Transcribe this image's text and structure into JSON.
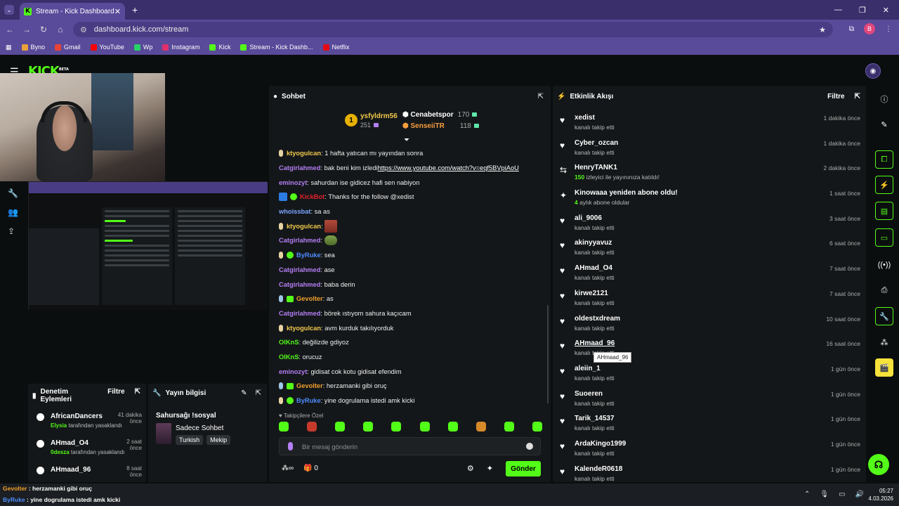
{
  "browser": {
    "tab_title": "Stream - Kick Dashboard",
    "url": "dashboard.kick.com/stream",
    "profile_initial": "B",
    "bookmarks": [
      {
        "label": "Byno",
        "color": "#e9a23b"
      },
      {
        "label": "Gmail",
        "color": "#ea4335"
      },
      {
        "label": "YouTube",
        "color": "#ff0000"
      },
      {
        "label": "Wp",
        "color": "#25d366"
      },
      {
        "label": "Instagram",
        "color": "#e1306c"
      },
      {
        "label": "Kick",
        "color": "#53fc18"
      },
      {
        "label": "Stream - Kick Dashb...",
        "color": "#53fc18"
      },
      {
        "label": "Netflix",
        "color": "#e50914"
      }
    ]
  },
  "kick": {
    "logo": "KICK",
    "logo_sup": "BETA"
  },
  "chat": {
    "title": "Sohbet",
    "leaderboard": {
      "rank": "1",
      "top_user": "ysfyldrm56",
      "top_count": "251",
      "second_user": "Cenabetspor",
      "second_count": "170",
      "third_user": "SenseiiTR",
      "third_count": "118"
    },
    "messages": [
      {
        "badges": "sub",
        "user": "ktyogulcan",
        "color": "#f2c94c",
        "text": "1 hafta yatıcan mı yayından sonra"
      },
      {
        "badges": "",
        "user": "Catgirlahmed",
        "color": "#b47ff5",
        "text": "bak beni kim izledi ",
        "link": "https://www.youtube.com/watch?v=eqf5BVpiAoU"
      },
      {
        "badges": "",
        "user": "eminozyt",
        "color": "#b47ff5",
        "text": "sahurdan ise gidicez hafi sen nabiyon"
      },
      {
        "badges": "bot",
        "user": "KickBot",
        "color": "#e0202a",
        "text": "Thanks for the follow @xedist"
      },
      {
        "badges": "",
        "user": "whoissbat",
        "color": "#7aa6ff",
        "text": "sa as"
      },
      {
        "badges": "sub",
        "user": "ktyogulcan",
        "color": "#f2c94c",
        "text": "",
        "emote": "red"
      },
      {
        "badges": "",
        "user": "Catgirlahmed",
        "color": "#b47ff5",
        "text": "",
        "emote": "frog"
      },
      {
        "badges": "subv",
        "user": "ByRuke",
        "color": "#4e8cff",
        "text": "sea"
      },
      {
        "badges": "",
        "user": "Catgirlahmed",
        "color": "#b47ff5",
        "text": "ase"
      },
      {
        "badges": "",
        "user": "Catgirlahmed",
        "color": "#b47ff5",
        "text": "baba derin"
      },
      {
        "badges": "blueg",
        "user": "Gevolter",
        "color": "#f0a02a",
        "text": "as"
      },
      {
        "badges": "",
        "user": "Catgirlahmed",
        "color": "#b47ff5",
        "text": "börek ıstıyom sahura kaçıcam"
      },
      {
        "badges": "sub",
        "user": "ktyogulcan",
        "color": "#f2c94c",
        "text": "avm kurduk takılıyorduk"
      },
      {
        "badges": "",
        "user": "OlKnS",
        "color": "#53fc18",
        "text": "değilizde gdiyoz"
      },
      {
        "badges": "",
        "user": "OlKnS",
        "color": "#53fc18",
        "text": "orucuz"
      },
      {
        "badges": "",
        "user": "eminozyt",
        "color": "#b47ff5",
        "text": "gidisat cok kotu gidisat efendim"
      },
      {
        "badges": "blueg",
        "user": "Gevolter",
        "color": "#f0a02a",
        "text": "herzamanki gibi oruç"
      },
      {
        "badges": "subv",
        "user": "ByRuke",
        "color": "#4e8cff",
        "text": "yine dogrulama istedi amk kicki"
      }
    ],
    "follow_only_label": "Takipçilere Özel",
    "input_placeholder": "Bir mesaj gönderin",
    "points_label": "0",
    "send_label": "Gönder"
  },
  "activity": {
    "title": "Etkinlik Akışı",
    "filter_label": "Filtre",
    "events": [
      {
        "icon": "heart",
        "name": "xedist",
        "sub": "kanalı takip etti",
        "time": "1 dakika önce"
      },
      {
        "icon": "heart",
        "name": "Cyber_ozcan",
        "sub": "kanalı takip etti",
        "time": "1 dakika önce"
      },
      {
        "icon": "host",
        "name": "HenryTANK1",
        "sub_num": "150",
        "sub": " izleyici ile yayınınıza katıldı!",
        "time": "2 dakika önce"
      },
      {
        "icon": "star",
        "name": "Kinowaaa yeniden abone oldu!",
        "sub_num": "4",
        "sub": " aylık abone oldular",
        "time": "1 saat önce"
      },
      {
        "icon": "heart",
        "name": "ali_9006",
        "sub": "kanalı takip etti",
        "time": "3 saat önce"
      },
      {
        "icon": "heart",
        "name": "akinyyavuz",
        "sub": "kanalı takip etti",
        "time": "6 saat önce"
      },
      {
        "icon": "heart",
        "name": "AHmad_O4",
        "sub": "kanalı takip etti",
        "time": "7 saat önce"
      },
      {
        "icon": "heart",
        "name": "kirwe2121",
        "sub": "kanalı takip etti",
        "time": "7 saat önce"
      },
      {
        "icon": "heart",
        "name": "oldestxdream",
        "sub": "kanalı takip etti",
        "time": "10 saat önce"
      },
      {
        "icon": "heart",
        "name": "AHmaad_96",
        "sub": "kanalı takip etti",
        "time": "16 saat önce"
      },
      {
        "icon": "heart",
        "name": "aleiin_1",
        "sub": "kanalı takip etti",
        "time": "1 gün önce"
      },
      {
        "icon": "heart",
        "name": "Suoeren",
        "sub": "kanalı takip etti",
        "time": "1 gün önce"
      },
      {
        "icon": "heart",
        "name": "Tarik_14537",
        "sub": "kanalı takip etti",
        "time": "1 gün önce"
      },
      {
        "icon": "heart",
        "name": "ArdaKingo1999",
        "sub": "kanalı takip etti",
        "time": "1 gün önce"
      },
      {
        "icon": "heart",
        "name": "KalendeR0618",
        "sub": "kanalı takip etti",
        "time": "1 gün önce"
      }
    ],
    "tooltip": "AHmaad_96"
  },
  "moderation": {
    "title_line1": "Denetim",
    "title_line2": "Eylemleri",
    "filter_label": "Filtre",
    "items": [
      {
        "name": "AfricanDancers",
        "by": "Elysia",
        "action": " tarafından yasaklandı",
        "time": "41 dakika önce"
      },
      {
        "name": "AHmad_O4",
        "by": "0desza",
        "action": " tarafından yasaklandı",
        "time": "2 saat önce"
      },
      {
        "name": "AHmaad_96",
        "by": "",
        "action": "",
        "time": "8 saat önce"
      }
    ]
  },
  "stream_info": {
    "title": "Yayın bilgisi",
    "stream_title": "Sahursağı !sosyal",
    "category": "Sadece Sohbet",
    "tags": [
      "Turkish",
      "Mekip"
    ]
  },
  "taskbar": {
    "overlay_line1_user": "Gevolter",
    "overlay_line1_text": " : herzamanki gibi oruç",
    "overlay_line2_user": "ByRuke",
    "overlay_line2_text": " : yine dogrulama istedi amk kicki",
    "time": "05:27",
    "date": "4.03.2026"
  }
}
